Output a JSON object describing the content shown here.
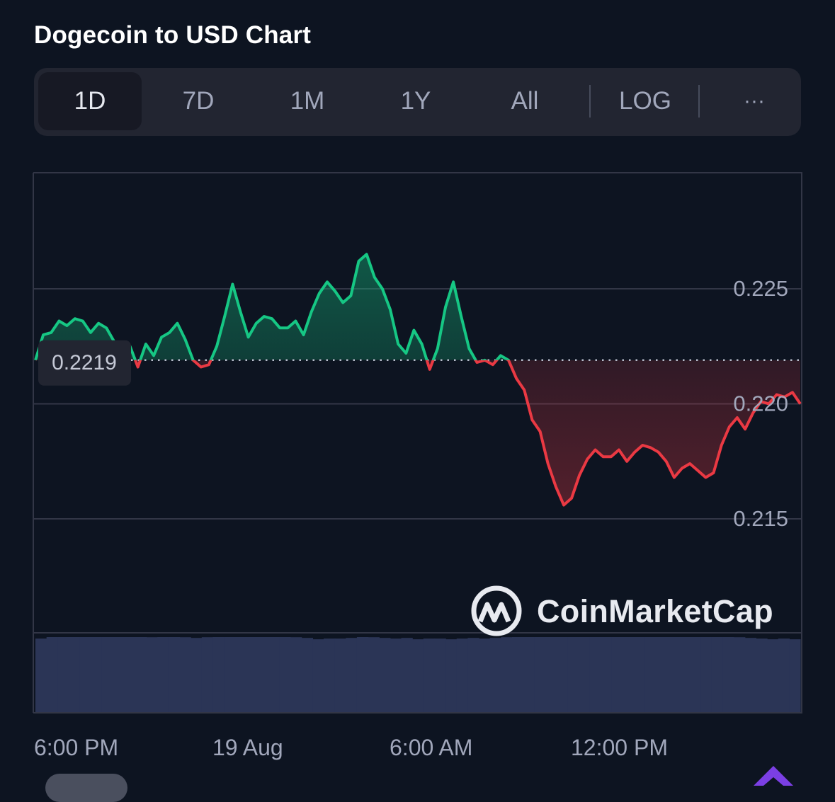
{
  "title": "Dogecoin to USD Chart",
  "tabs": [
    {
      "label": "1D",
      "active": true
    },
    {
      "label": "7D",
      "active": false
    },
    {
      "label": "1M",
      "active": false
    },
    {
      "label": "1Y",
      "active": false
    },
    {
      "label": "All",
      "active": false
    },
    {
      "label": "LOG",
      "active": false
    },
    {
      "label": "···",
      "active": false
    }
  ],
  "watermark": "CoinMarketCap",
  "colors": {
    "up": "#16c784",
    "down": "#ea3943",
    "background": "#0d1421",
    "volume": "#2b3556"
  },
  "chart_data": {
    "type": "line",
    "baseline": 0.2219,
    "baseline_label": "0.2219",
    "ylim": [
      0.21,
      0.23
    ],
    "y_ticks": [
      0.225,
      0.22,
      0.215
    ],
    "y_tick_labels": [
      "0.225",
      "0.220",
      "0.215"
    ],
    "x_tick_labels": [
      "6:00 PM",
      "19 Aug",
      "6:00 AM",
      "12:00 PM"
    ],
    "grid": true,
    "series": [
      {
        "values": [
          0.2219,
          0.223,
          0.2231,
          0.2236,
          0.2234,
          0.2237,
          0.2236,
          0.2231,
          0.2235,
          0.2233,
          0.2227,
          0.2218,
          0.2225,
          0.2216,
          0.2226,
          0.2221,
          0.2229,
          0.2231,
          0.2235,
          0.2228,
          0.2219,
          0.2216,
          0.2217,
          0.2225,
          0.2238,
          0.2252,
          0.224,
          0.2229,
          0.2235,
          0.2238,
          0.2237,
          0.2233,
          0.2233,
          0.2236,
          0.223,
          0.224,
          0.2248,
          0.2253,
          0.2249,
          0.2244,
          0.2247,
          0.2262,
          0.2265,
          0.2255,
          0.225,
          0.2241,
          0.2226,
          0.2222,
          0.2232,
          0.2226,
          0.2215,
          0.2224,
          0.2242,
          0.2253,
          0.2238,
          0.2224,
          0.2218,
          0.2219,
          0.2217,
          0.2221,
          0.2219,
          0.2211,
          0.2206,
          0.2193,
          0.2188,
          0.2174,
          0.2164,
          0.2156,
          0.2159,
          0.2169,
          0.2176,
          0.218,
          0.2177,
          0.2177,
          0.218,
          0.2175,
          0.2179,
          0.2182,
          0.2181,
          0.2179,
          0.2175,
          0.2168,
          0.2172,
          0.2174,
          0.2171,
          0.2168,
          0.217,
          0.2182,
          0.219,
          0.2194,
          0.2189,
          0.2196,
          0.2201,
          0.22,
          0.2204,
          0.2203,
          0.2205,
          0.22
        ]
      }
    ],
    "volume": [
      0.7,
      0.75,
      0.76,
      0.75,
      0.78,
      0.77,
      0.76,
      0.75,
      0.73,
      0.74,
      0.72,
      0.73,
      0.74,
      0.72,
      0.71,
      0.72,
      0.74,
      0.73,
      0.73,
      0.74,
      0.73,
      0.74,
      0.73,
      0.72,
      0.71,
      0.69,
      0.7,
      0.7,
      0.71,
      0.73,
      0.72,
      0.71,
      0.7,
      0.71,
      0.69,
      0.7,
      0.7,
      0.69,
      0.7,
      0.71,
      0.7,
      0.71,
      0.72,
      0.73,
      0.74,
      0.76,
      0.75,
      0.73,
      0.73,
      0.74,
      0.73,
      0.73,
      0.74,
      0.75,
      0.74,
      0.73,
      0.74,
      0.73,
      0.75,
      0.76,
      0.73,
      0.74,
      0.73,
      0.72,
      0.71,
      0.7,
      0.69,
      0.7,
      0.69
    ]
  }
}
